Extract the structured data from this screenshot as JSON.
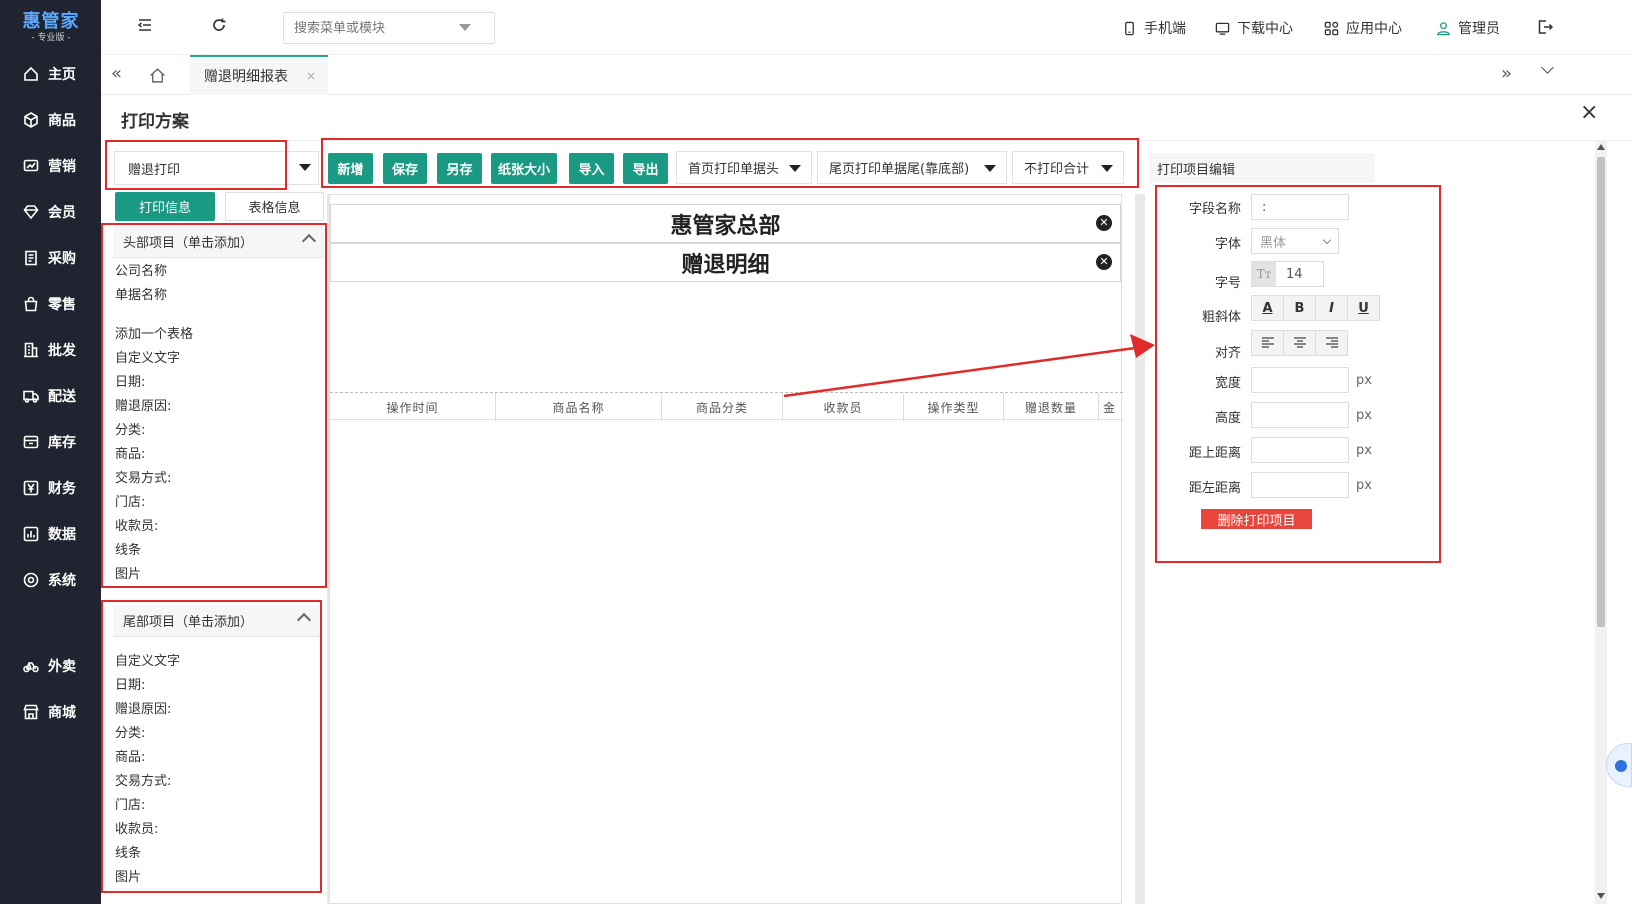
{
  "app": {
    "logo_main": "惠管家",
    "logo_sub": "- 专业版 -"
  },
  "sidebar": {
    "items": [
      {
        "label": "主页",
        "icon": "home-icon"
      },
      {
        "label": "商品",
        "icon": "cube-icon"
      },
      {
        "label": "营销",
        "icon": "chart-icon"
      },
      {
        "label": "会员",
        "icon": "diamond-icon"
      },
      {
        "label": "采购",
        "icon": "receipt-icon"
      },
      {
        "label": "零售",
        "icon": "bag-icon"
      },
      {
        "label": "批发",
        "icon": "building-icon"
      },
      {
        "label": "配送",
        "icon": "truck-icon"
      },
      {
        "label": "库存",
        "icon": "box-icon"
      },
      {
        "label": "财务",
        "icon": "yen-icon"
      },
      {
        "label": "数据",
        "icon": "bar-icon"
      },
      {
        "label": "系统",
        "icon": "gear-icon"
      },
      {
        "label": "外卖",
        "icon": "bike-icon"
      },
      {
        "label": "商城",
        "icon": "store-icon"
      }
    ]
  },
  "topbar": {
    "search_placeholder": "搜索菜单或模块",
    "mobile": "手机端",
    "download": "下载中心",
    "apps": "应用中心",
    "user": "管理员"
  },
  "tabs": {
    "active": "赠退明细报表",
    "close": "×"
  },
  "page": {
    "title": "打印方案",
    "close": "×"
  },
  "toolbar": {
    "scheme_select": "赠退打印",
    "buttons": [
      "新增",
      "保存",
      "另存",
      "纸张大小",
      "导入",
      "导出"
    ],
    "dropdowns": [
      "首页打印单据头",
      "尾页打印单据尾(靠底部)",
      "不打印合计"
    ]
  },
  "left": {
    "tab_print": "打印信息",
    "tab_table": "表格信息",
    "header_title": "头部项目（单击添加）",
    "header_items": [
      "公司名称",
      "单据名称",
      "",
      "添加一个表格",
      "自定义文字",
      "日期:",
      "赠退原因:",
      "分类:",
      "商品:",
      "交易方式:",
      "门店:",
      "收款员:",
      "线条",
      "图片"
    ],
    "footer_title": "尾部项目（单击添加）",
    "footer_items": [
      "自定义文字",
      "日期:",
      "赠退原因:",
      "分类:",
      "商品:",
      "交易方式:",
      "门店:",
      "收款员:",
      "线条",
      "图片"
    ]
  },
  "canvas": {
    "company": "惠管家总部",
    "doc_title": "赠退明细",
    "columns": [
      "操作时间",
      "商品名称",
      "商品分类",
      "收款员",
      "操作类型",
      "赠退数量",
      "金"
    ]
  },
  "editor": {
    "title": "打印项目编辑",
    "field_name_label": "字段名称",
    "field_name_value": ":",
    "font_label": "字体",
    "font_value": "黑体",
    "size_label": "字号",
    "size_icon": "Tт",
    "size_value": "14",
    "style_label": "粗斜体",
    "style_buttons": [
      "A",
      "B",
      "I",
      "U"
    ],
    "align_label": "对齐",
    "width_label": "宽度",
    "height_label": "高度",
    "top_label": "距上距离",
    "left_label": "距左距离",
    "unit": "px",
    "delete_button": "删除打印项目"
  },
  "colors": {
    "accent": "#1a9a83",
    "sidebar": "#1f2430",
    "highlight": "#e02b2b",
    "danger": "#e8453c"
  }
}
